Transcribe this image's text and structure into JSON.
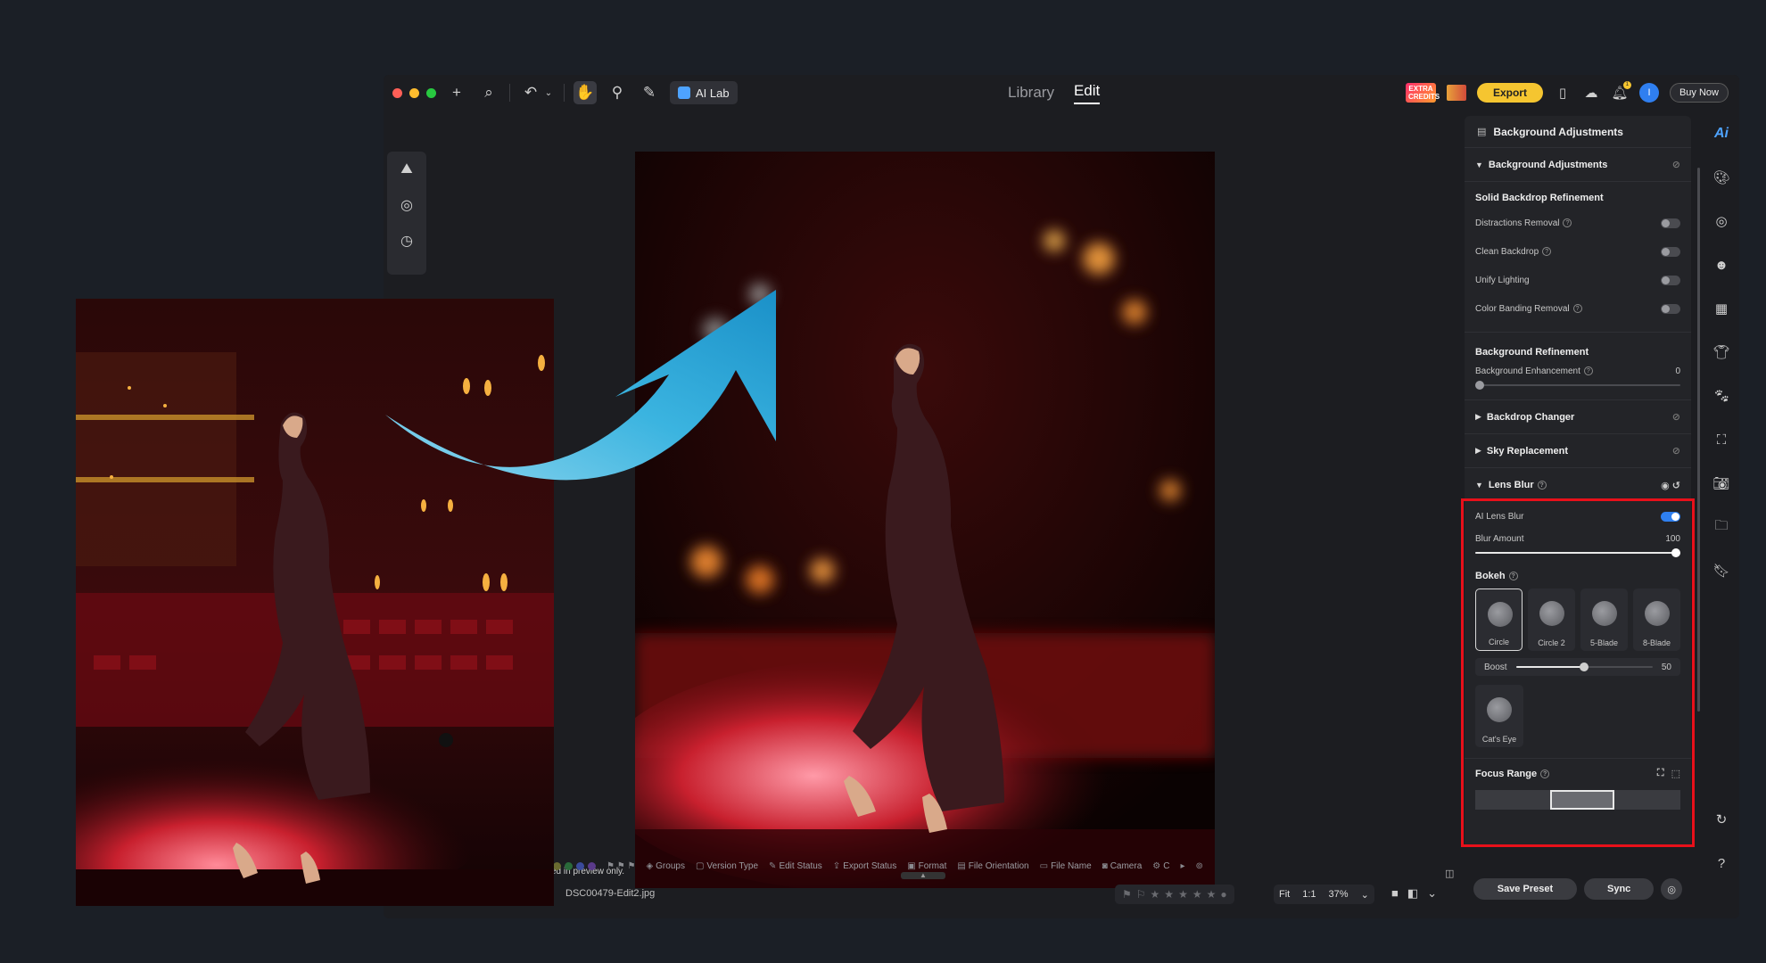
{
  "titlebar": {
    "ai_lab_label": "AI Lab",
    "modes": [
      "Library",
      "Edit"
    ],
    "active_mode": "Edit",
    "credits_label": "EXTRA CREDITS",
    "export_label": "Export",
    "notification_count": "1",
    "user_initial": "I",
    "buy_now_label": "Buy Now"
  },
  "photo": {
    "preview_note": "ed in preview only.",
    "filename": "DSC00479-Edit2.jpg"
  },
  "filterbar": {
    "items": [
      "Groups",
      "Version Type",
      "Edit Status",
      "Export Status",
      "Format",
      "File Orientation",
      "File Name",
      "Camera",
      "C"
    ]
  },
  "zoom": {
    "fit_label": "Fit",
    "one_to_one_label": "1:1",
    "percent": "37%"
  },
  "panel": {
    "header_title": "Background Adjustments",
    "section_bg_title": "Background Adjustments",
    "solid_backdrop_title": "Solid Backdrop Refinement",
    "toggles": [
      {
        "label": "Distractions Removal",
        "on": false
      },
      {
        "label": "Clean Backdrop",
        "on": false
      },
      {
        "label": "Unify Lighting",
        "on": false
      },
      {
        "label": "Color Banding Removal",
        "on": false
      }
    ],
    "bg_refinement_title": "Background Refinement",
    "bg_enhancement_label": "Background Enhancement",
    "bg_enhancement_value": "0",
    "backdrop_changer_title": "Backdrop Changer",
    "sky_replacement_title": "Sky Replacement",
    "lens_blur": {
      "title": "Lens Blur",
      "ai_lens_blur_label": "AI Lens Blur",
      "ai_lens_blur_on": true,
      "blur_amount_label": "Blur Amount",
      "blur_amount_value": "100",
      "bokeh_title": "Bokeh",
      "bokeh_options": [
        "Circle",
        "Circle 2",
        "5-Blade",
        "8-Blade"
      ],
      "bokeh_selected": "Circle",
      "boost_label": "Boost",
      "boost_value": "50",
      "cats_eye_label": "Cat's Eye",
      "focus_range_title": "Focus Range"
    },
    "save_preset_label": "Save Preset",
    "sync_label": "Sync"
  },
  "colors": {
    "accent_blue": "#2f80f0",
    "export_yellow": "#f5c530",
    "highlight_red": "#e8101a",
    "arrow_cyan": "#3bb4e0"
  }
}
